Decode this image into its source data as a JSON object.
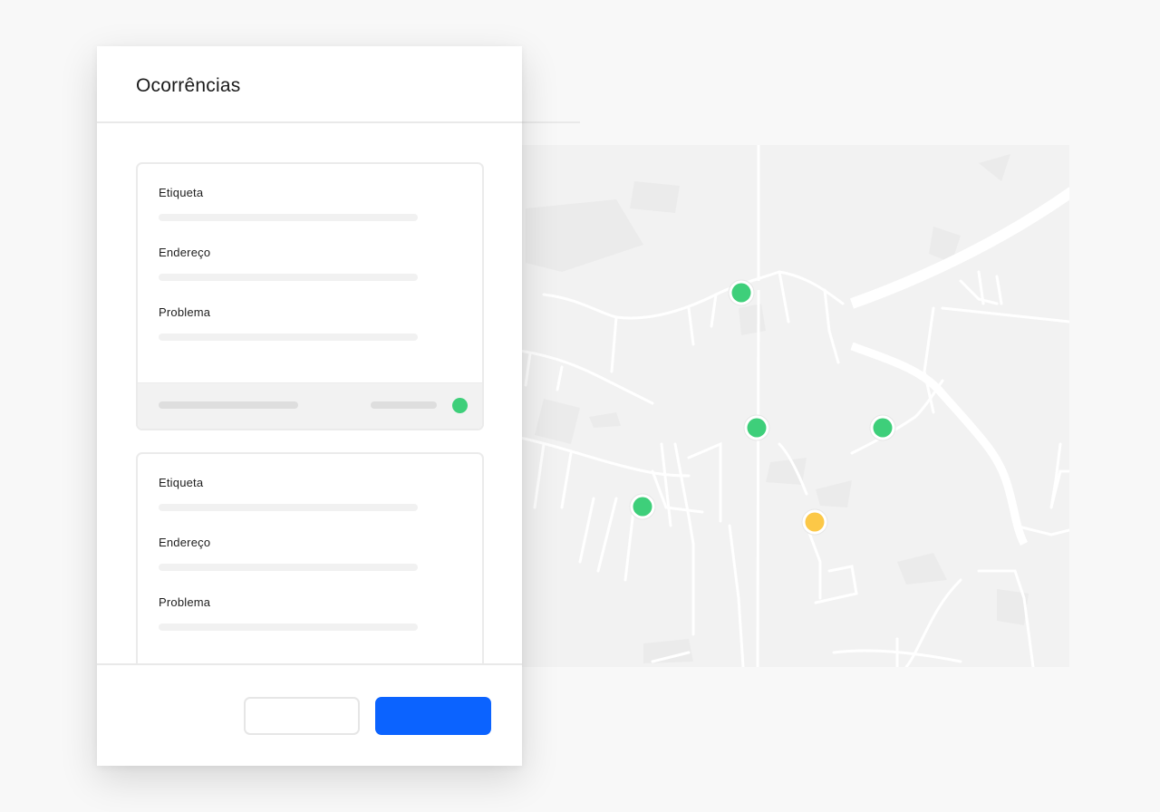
{
  "panel": {
    "title": "Ocorrências",
    "cards": [
      {
        "fields": [
          {
            "label": "Etiqueta"
          },
          {
            "label": "Endereço"
          },
          {
            "label": "Problema"
          }
        ],
        "status_color": "#3ecf7a"
      },
      {
        "fields": [
          {
            "label": "Etiqueta"
          },
          {
            "label": "Endereço"
          },
          {
            "label": "Problema"
          }
        ]
      }
    ],
    "footer": {
      "secondary_label": "",
      "primary_label": ""
    }
  },
  "map": {
    "markers": [
      {
        "status": "green",
        "color": "#3ecf7a"
      },
      {
        "status": "green",
        "color": "#3ecf7a"
      },
      {
        "status": "green",
        "color": "#3ecf7a"
      },
      {
        "status": "green",
        "color": "#3ecf7a"
      },
      {
        "status": "yellow",
        "color": "#fcc847"
      }
    ]
  },
  "colors": {
    "accent": "#0b63ff",
    "status_ok": "#3ecf7a",
    "status_warning": "#fcc847"
  }
}
